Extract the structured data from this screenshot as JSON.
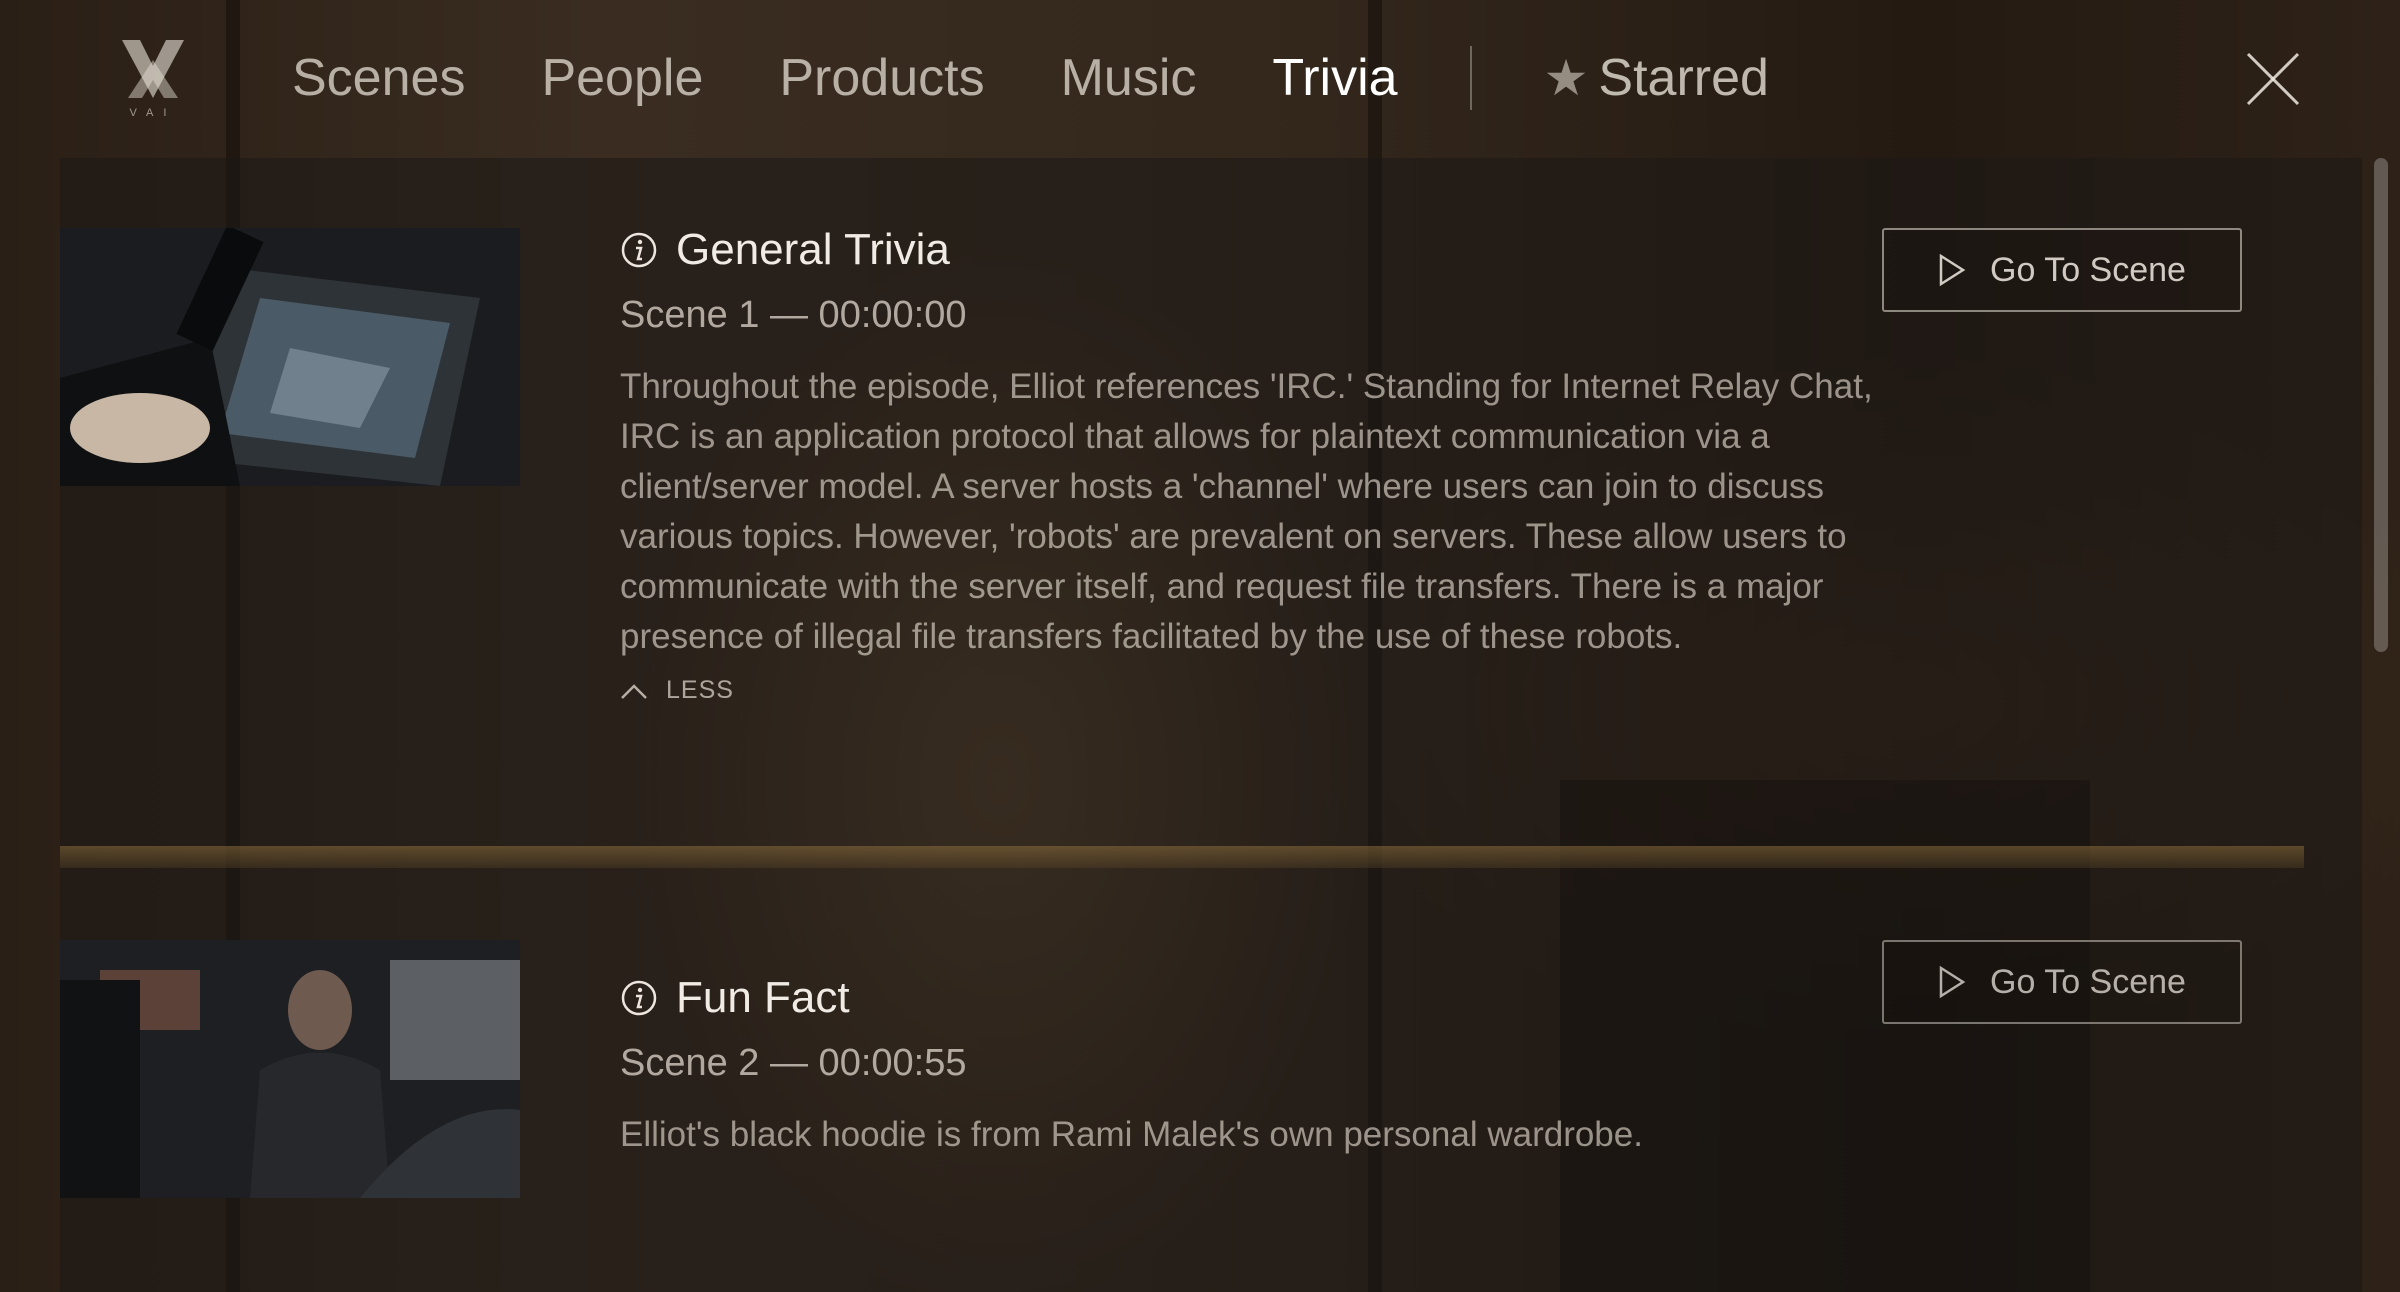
{
  "header": {
    "logo_text": "VAI",
    "tabs": [
      {
        "label": "Scenes"
      },
      {
        "label": "People"
      },
      {
        "label": "Products"
      },
      {
        "label": "Music"
      },
      {
        "label": "Trivia",
        "active": true
      }
    ],
    "starred_label": "Starred",
    "icons": {
      "star": "star-icon",
      "close": "close-icon"
    }
  },
  "items": [
    {
      "title": "General Trivia",
      "scene": "Scene 1 — 00:00:00",
      "description": "Throughout the episode, Elliot references 'IRC.' Standing for Internet Relay Chat, IRC is an application protocol that allows for plaintext communication via a client/server model. A server hosts a 'channel' where users can join to discuss various topics. However, 'robots' are prevalent on servers. These allow users to communicate with the server itself, and request file transfers. There is a major presence of illegal file transfers facilitated by the use of these robots.",
      "toggle_label": "LESS",
      "button_label": "Go To Scene"
    },
    {
      "title": "Fun Fact",
      "scene": "Scene 2 — 00:00:55",
      "description": "Elliot's black hoodie is from Rami Malek's own personal wardrobe.",
      "button_label": "Go To Scene"
    }
  ],
  "colors": {
    "accent": "#ffffff",
    "text_muted": "#b9b0a5"
  }
}
